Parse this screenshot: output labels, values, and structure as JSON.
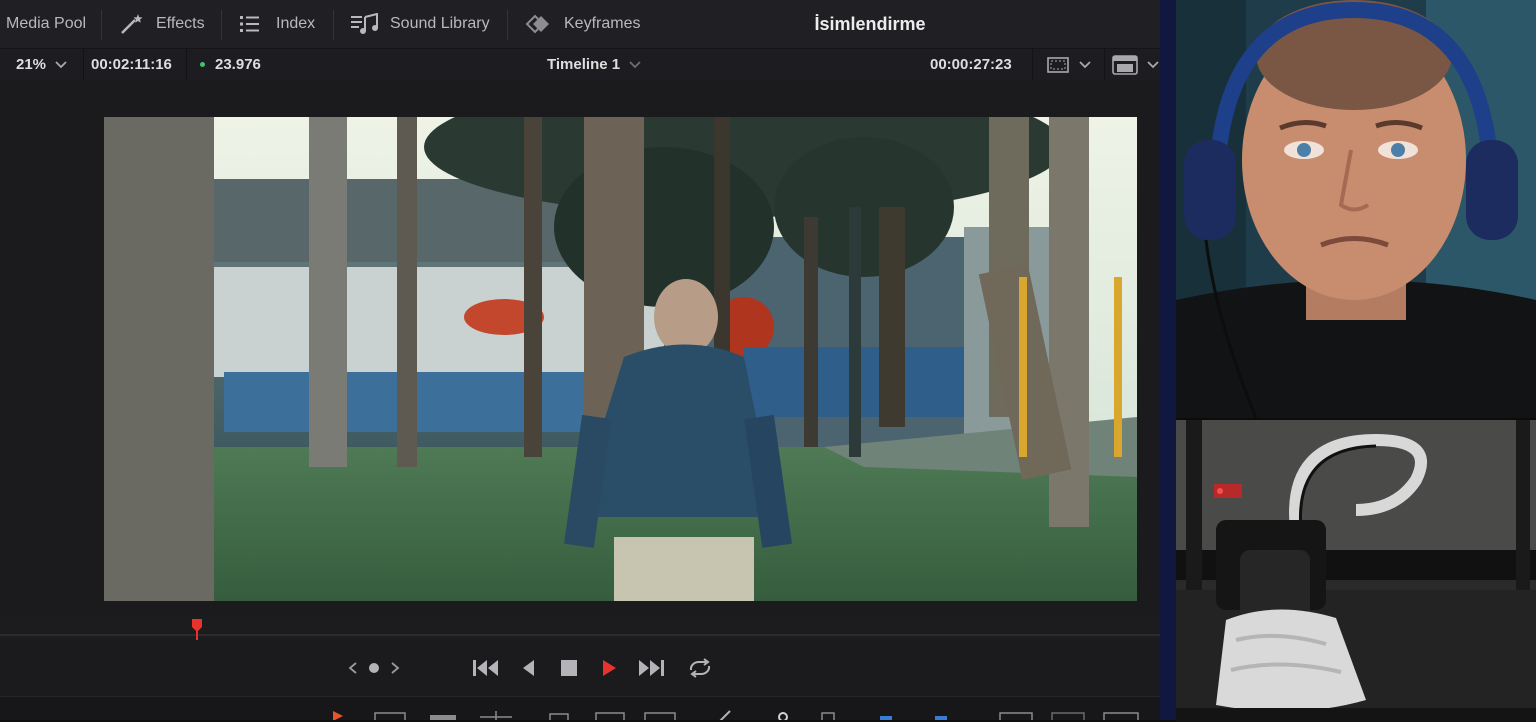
{
  "toolbar": {
    "media_pool": "Media Pool",
    "effects": "Effects",
    "index": "Index",
    "sound_library": "Sound Library",
    "keyframes": "Keyframes"
  },
  "page_title": "İsimlendirme",
  "viewer_bar": {
    "zoom": "21%",
    "source_timecode": "00:02:11:16",
    "frame_rate": "23.976",
    "timeline_name": "Timeline 1",
    "record_timecode": "00:00:27:23"
  },
  "playhead_progress": 0.17,
  "colors": {
    "panel_bg": "#1b1b1e",
    "toolbar_bg": "#202024",
    "accent_red": "#e8322c",
    "framerate_dot": "#3ec46d",
    "cam_divider": "#10183f"
  }
}
